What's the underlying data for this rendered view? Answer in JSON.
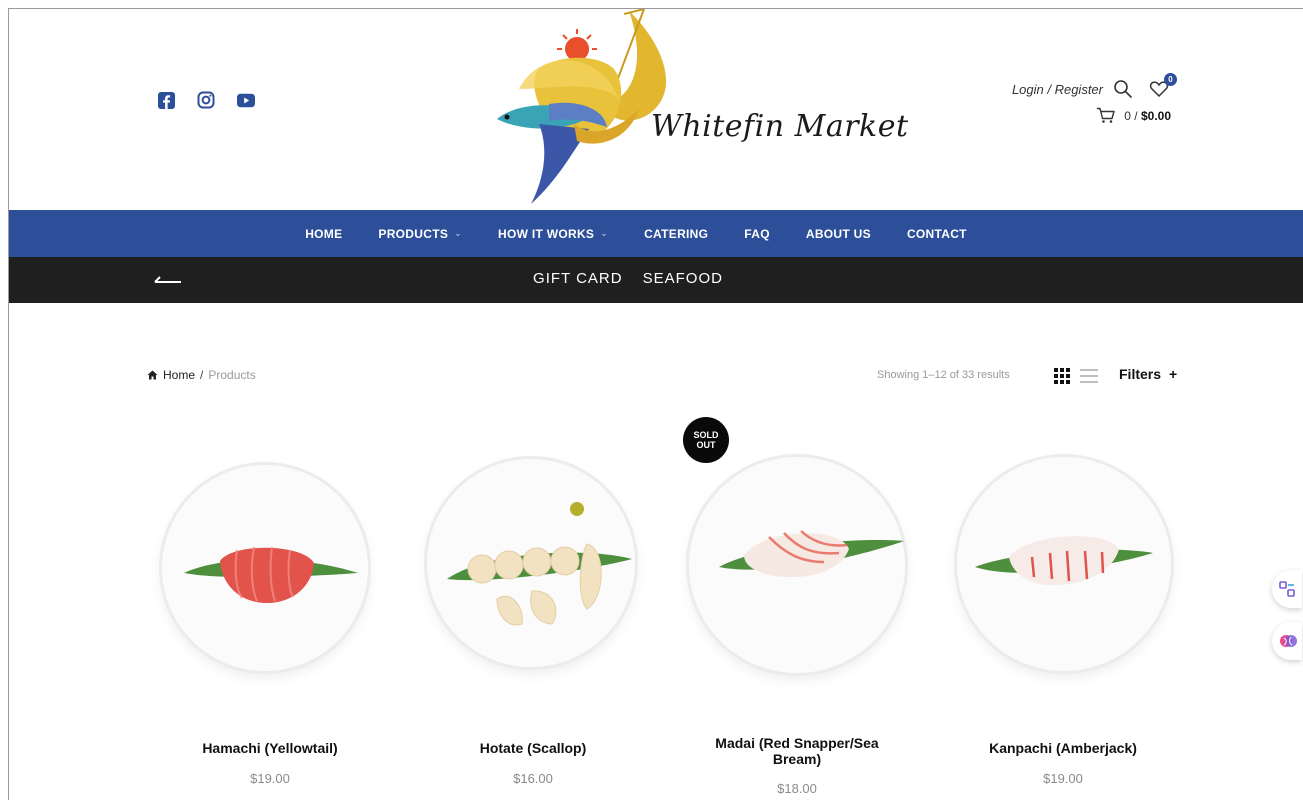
{
  "header": {
    "social": [
      "facebook-icon",
      "instagram-icon",
      "youtube-icon"
    ],
    "brand": "Whitefin Market",
    "login_label": "Login / Register",
    "wishlist_count": "0",
    "cart_count": "0",
    "cart_sep": "/",
    "cart_total": "$0.00"
  },
  "nav": {
    "items": [
      {
        "label": "HOME",
        "dropdown": false
      },
      {
        "label": "PRODUCTS",
        "dropdown": true
      },
      {
        "label": "HOW IT WORKS",
        "dropdown": true
      },
      {
        "label": "CATERING",
        "dropdown": false
      },
      {
        "label": "FAQ",
        "dropdown": false
      },
      {
        "label": "ABOUT US",
        "dropdown": false
      },
      {
        "label": "CONTACT",
        "dropdown": false
      }
    ]
  },
  "subnav": {
    "links": [
      "GIFT CARD",
      "SEAFOOD"
    ]
  },
  "breadcrumb": {
    "home": "Home",
    "sep": "/",
    "current": "Products"
  },
  "toolbar": {
    "results": "Showing 1–12 of 33 results",
    "filters": "Filters",
    "filters_plus": "+"
  },
  "products": [
    {
      "name": "Hamachi (Yellowtail)",
      "price": "$19.00",
      "sold_out": false
    },
    {
      "name": "Hotate (Scallop)",
      "price": "$16.00",
      "sold_out": false
    },
    {
      "name": "Madai (Red Snapper/Sea Bream)",
      "price": "$18.00",
      "sold_out": true,
      "badge": "SOLD OUT"
    },
    {
      "name": "Kanpachi (Amberjack)",
      "price": "$19.00",
      "sold_out": false
    }
  ],
  "colors": {
    "nav_bg": "#2d4f9a",
    "subnav_bg": "#1f1f1f",
    "social": "#2d4f9a"
  }
}
